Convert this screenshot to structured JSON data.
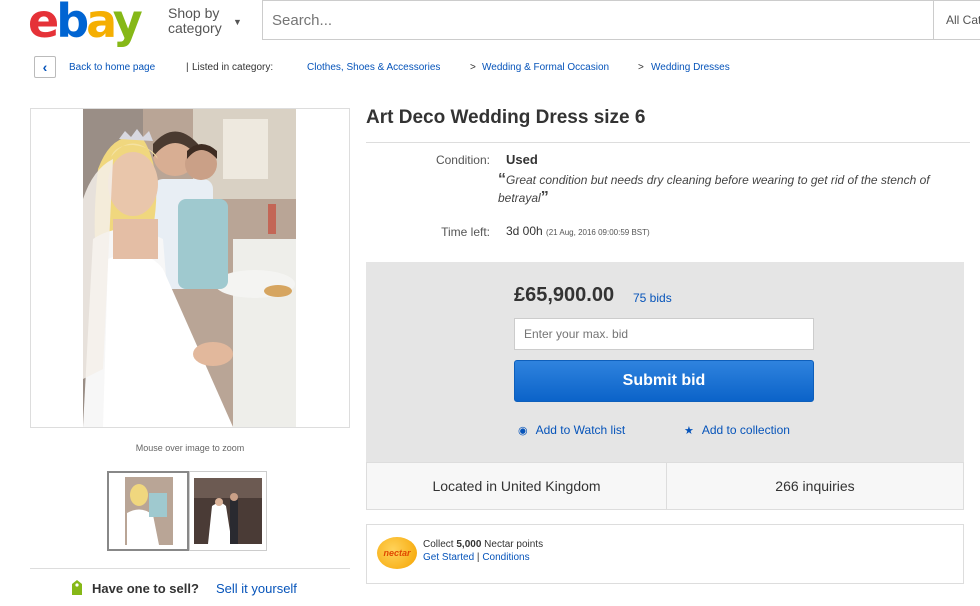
{
  "header": {
    "logo": [
      "e",
      "b",
      "a",
      "y"
    ],
    "shop_by_line1": "Shop by",
    "shop_by_line2": "category",
    "search_placeholder": "Search...",
    "all_categories": "All Categories"
  },
  "breadcrumb": {
    "back_label": "Back to home page",
    "separator": "|",
    "listed_in": "Listed in category:",
    "path": [
      "Clothes, Shoes & Accessories",
      "Wedding & Formal Occasion",
      "Wedding Dresses"
    ],
    "arrow": ">"
  },
  "gallery": {
    "zoom_hint": "Mouse over image to zoom"
  },
  "sell": {
    "question": "Have one to sell?",
    "link": "Sell it yourself"
  },
  "item": {
    "title": "Art Deco Wedding Dress size 6",
    "condition_label": "Condition:",
    "condition_value": "Used",
    "condition_note": "Great condition but needs dry cleaning before wearing to get rid of the stench of betrayal",
    "time_left_label": "Time left:",
    "time_left_value": "3d 00h",
    "time_left_detail": "(21 Aug, 2016  09:00:59 BST)"
  },
  "bid": {
    "price": "£65,900.00",
    "bids": "75 bids",
    "max_bid_placeholder": "Enter your max. bid",
    "submit_label": "Submit bid",
    "watch_label": "Add to Watch list",
    "collection_label": "Add to collection"
  },
  "location": {
    "located": "Located in United Kingdom",
    "inquiries": "266 inquiries"
  },
  "nectar": {
    "logo_text": "nectar",
    "collect_prefix": "Collect",
    "points": "5,000",
    "collect_suffix": "Nectar points",
    "get_started": "Get Started",
    "divider": "|",
    "conditions": "Conditions"
  },
  "colors": {
    "link": "#0654ba",
    "submit": "#0b63c9",
    "bidbox_bg": "#e5e5e5",
    "logo_red": "#e53238",
    "logo_blue": "#0064d2",
    "logo_yellow": "#f5af02",
    "logo_green": "#86b817"
  }
}
